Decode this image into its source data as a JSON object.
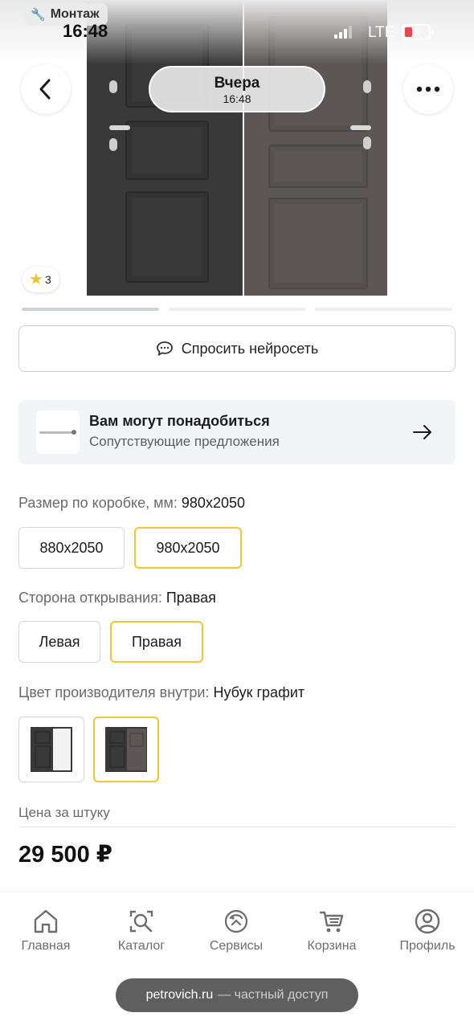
{
  "status_bar": {
    "time": "16:48",
    "network": "LTE",
    "back_app": "Монтаж"
  },
  "header": {
    "date_day": "Вчера",
    "date_time": "16:48"
  },
  "gallery": {
    "rating": "3",
    "image_index": 1,
    "image_count": 3
  },
  "ask_ai": {
    "label": "Спросить нейросеть"
  },
  "related": {
    "title": "Вам могут понадобиться",
    "subtitle": "Сопутствующие предложения"
  },
  "size": {
    "label": "Размер по коробке, мм:",
    "value": "980x2050",
    "options": [
      "880x2050",
      "980x2050"
    ],
    "selected": 1
  },
  "side": {
    "label": "Сторона открывания:",
    "value": "Правая",
    "options": [
      "Левая",
      "Правая"
    ],
    "selected": 1
  },
  "color": {
    "label": "Цвет производителя внутри:",
    "value": "Нубук графит",
    "selected": 1
  },
  "price": {
    "label": "Цена за  штуку",
    "value": "29 500 ₽"
  },
  "tabs": [
    {
      "label": "Главная",
      "icon": "home-icon"
    },
    {
      "label": "Каталог",
      "icon": "catalog-search-icon"
    },
    {
      "label": "Сервисы",
      "icon": "services-icon"
    },
    {
      "label": "Корзина",
      "icon": "cart-icon"
    },
    {
      "label": "Профиль",
      "icon": "profile-icon"
    }
  ],
  "browser": {
    "domain": "petrovich.ru",
    "note": "— частный доступ"
  },
  "colors": {
    "accent": "#f3c531",
    "text": "#1c1c1c",
    "muted": "#6a6a6a"
  }
}
